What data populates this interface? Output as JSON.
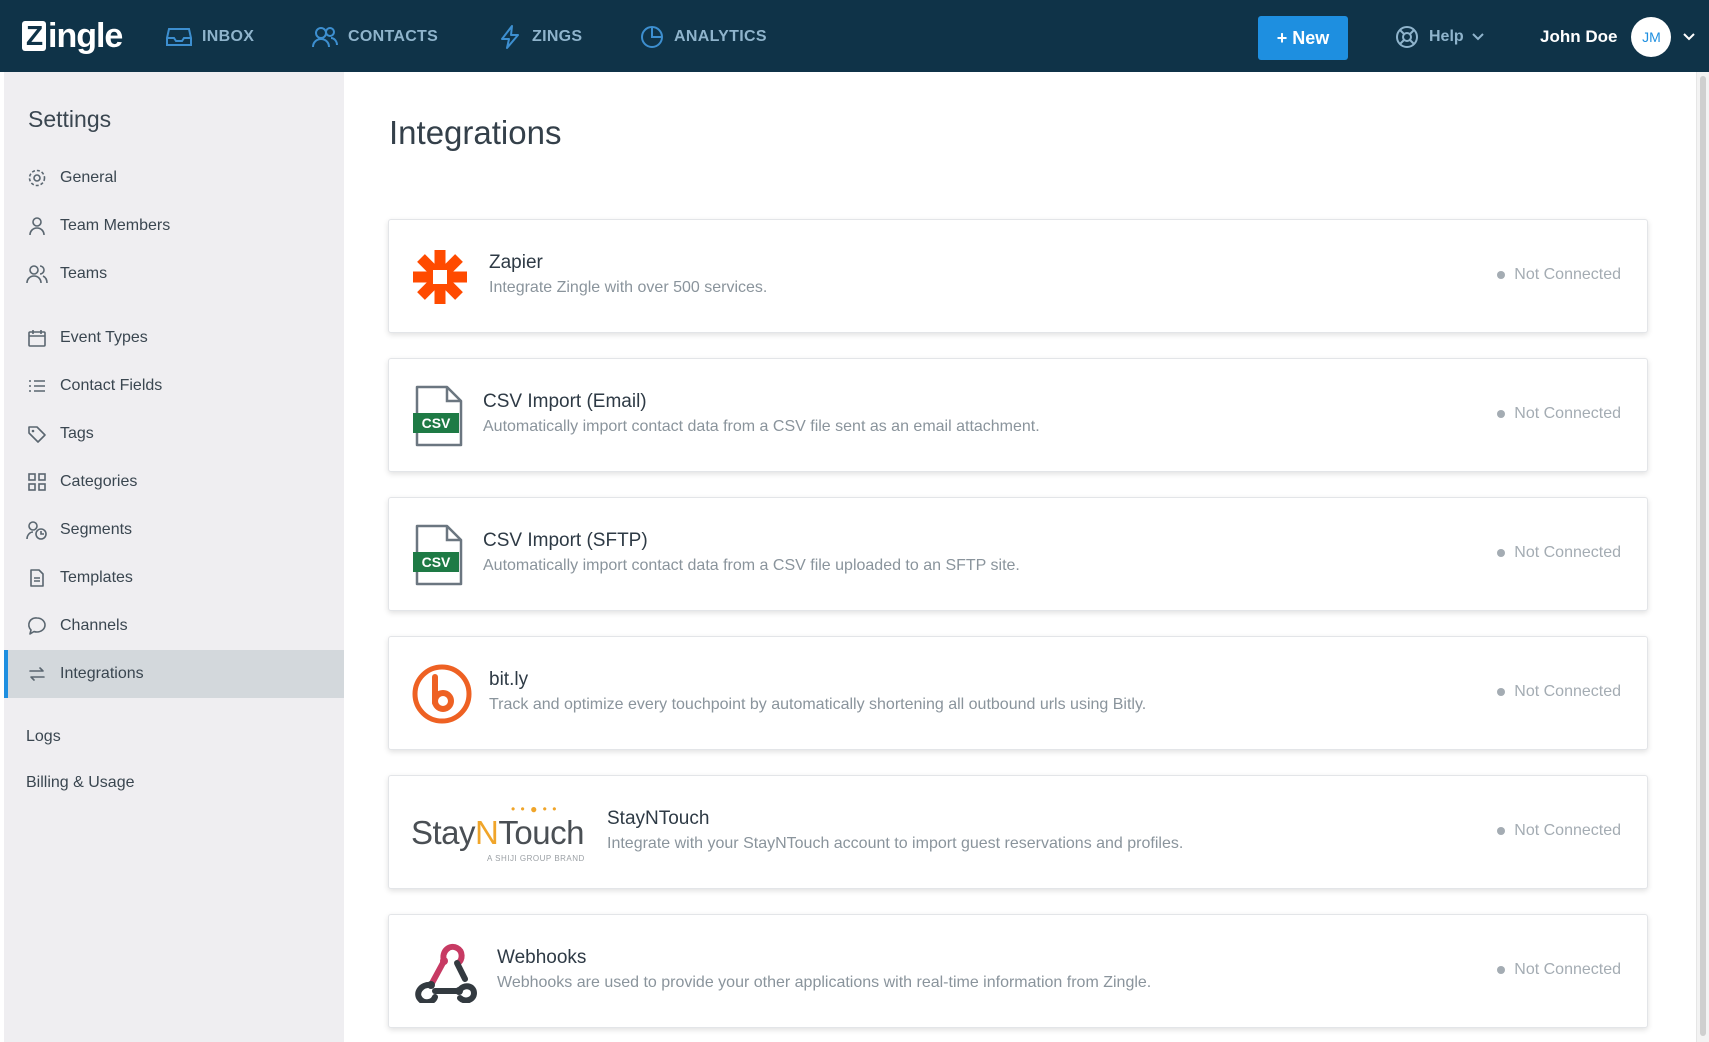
{
  "brand": {
    "logo_text": "ingle",
    "logo_initial": "Z"
  },
  "nav": {
    "items": [
      {
        "label": "INBOX",
        "icon": "inbox-icon"
      },
      {
        "label": "CONTACTS",
        "icon": "contacts-icon"
      },
      {
        "label": "ZINGS",
        "icon": "bolt-icon"
      },
      {
        "label": "ANALYTICS",
        "icon": "pie-chart-icon"
      }
    ],
    "new_button": "+ New",
    "help_label": "Help",
    "user_name": "John Doe",
    "user_initials": "JM"
  },
  "sidebar": {
    "title": "Settings",
    "items": [
      {
        "label": "General",
        "icon": "gear-icon"
      },
      {
        "label": "Team Members",
        "icon": "user-icon"
      },
      {
        "label": "Teams",
        "icon": "users-icon"
      },
      {
        "label": "Event Types",
        "icon": "calendar-icon"
      },
      {
        "label": "Contact Fields",
        "icon": "list-icon"
      },
      {
        "label": "Tags",
        "icon": "tag-icon"
      },
      {
        "label": "Categories",
        "icon": "grid-icon"
      },
      {
        "label": "Segments",
        "icon": "segments-icon"
      },
      {
        "label": "Templates",
        "icon": "document-icon"
      },
      {
        "label": "Channels",
        "icon": "chat-icon"
      },
      {
        "label": "Integrations",
        "icon": "sync-icon",
        "active": true
      }
    ],
    "logs_label": "Logs",
    "billing_label": "Billing & Usage"
  },
  "main": {
    "title": "Integrations",
    "integrations": [
      {
        "name": "Zapier",
        "description": "Integrate Zingle with over 500 services.",
        "status": "Not Connected",
        "icon": "zapier-logo-icon"
      },
      {
        "name": "CSV Import (Email)",
        "description": "Automatically import contact data from a CSV file sent as an email attachment.",
        "status": "Not Connected",
        "icon": "csv-file-icon",
        "icon_text": "CSV"
      },
      {
        "name": "CSV Import (SFTP)",
        "description": "Automatically import contact data from a CSV file uploaded to an SFTP site.",
        "status": "Not Connected",
        "icon": "csv-file-icon",
        "icon_text": "CSV"
      },
      {
        "name": "bit.ly",
        "description": "Track and optimize every touchpoint by automatically shortening all outbound urls using Bitly.",
        "status": "Not Connected",
        "icon": "bitly-logo-icon"
      },
      {
        "name": "StayNTouch",
        "description": "Integrate with your StayNTouch account to import guest reservations and profiles.",
        "status": "Not Connected",
        "icon": "stayntouch-logo-icon",
        "logo_text_a": "Stay",
        "logo_text_b": "N",
        "logo_text_c": "Touch",
        "logo_sub": "A SHIJI GROUP BRAND"
      },
      {
        "name": "Webhooks",
        "description": "Webhooks are used to provide your other applications with real-time information from Zingle.",
        "status": "Not Connected",
        "icon": "webhooks-logo-icon"
      }
    ]
  },
  "colors": {
    "topbar": "#0f3348",
    "accent": "#1e8fe0",
    "zapier": "#ff4a00",
    "csv_green": "#1e7a45",
    "bitly": "#ee6123",
    "stayntouch_orange": "#f0a52a",
    "webhooks_red": "#c73a63"
  }
}
